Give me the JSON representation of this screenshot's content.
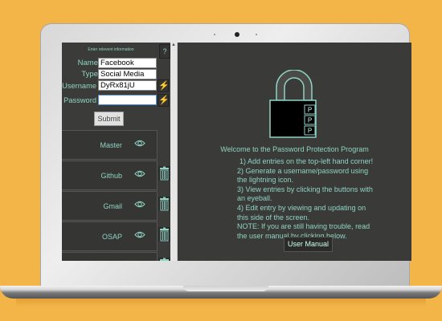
{
  "form": {
    "header": "Enter relevent information",
    "help_label": "?",
    "fields": [
      {
        "label": "Name",
        "value": "Facebook"
      },
      {
        "label": "Type",
        "value": "Social Media"
      },
      {
        "label": "Username",
        "value": "DyRx81jU"
      },
      {
        "label": "Password",
        "value": ""
      }
    ],
    "submit_label": "Submit"
  },
  "entries": [
    {
      "label": "Master"
    },
    {
      "label": "Github"
    },
    {
      "label": "Gmail"
    },
    {
      "label": "OSAP"
    },
    {
      "label": ""
    }
  ],
  "lock": {
    "tags": [
      "P",
      "P",
      "P"
    ]
  },
  "welcome": {
    "title": "Welcome to the Password Protection Program",
    "lines": [
      "1) Add entries on the top-left hand corner!",
      "2) Generate a username/password using",
      "the lightning icon.",
      "3) View entries by clicking the buttons with",
      "an eyeball.",
      "4) Edit entry by viewing and updating on",
      "this side of the screen.",
      "NOTE: If you are still having trouble, read",
      "the user manual by clicking below."
    ],
    "manual_label": "User Manual"
  },
  "colors": {
    "accent": "#8fd3c4",
    "background": "#f4b548",
    "panel": "#3a3b39"
  }
}
